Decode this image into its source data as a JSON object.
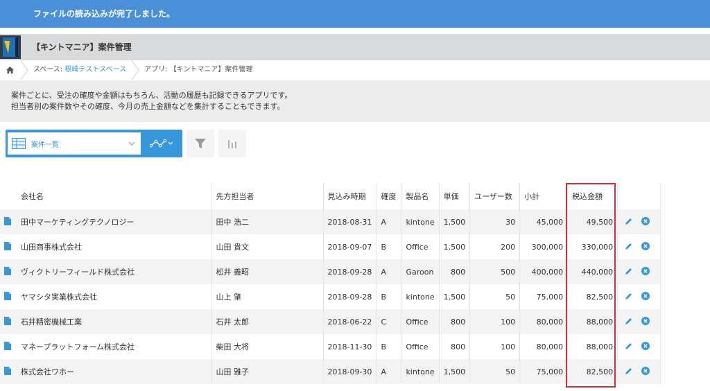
{
  "notification": "ファイルの読み込みが完了しました。",
  "app": {
    "title": "【キントマニア】案件管理"
  },
  "breadcrumb": {
    "space_prefix": "スペース: ",
    "space_name": "根崎テストスペース",
    "app_label": "アプリ: 【キントマニア】案件管理"
  },
  "description": {
    "line1": "案件ごとに、受注の確度や金額はもちろん、活動の履歴も記録できるアプリです。",
    "line2": "担当者別の案件数やその確度、今月の売上金額などを集計することもできます。"
  },
  "view": {
    "selected": "案件一覧"
  },
  "accent": "#3498db",
  "highlight_color": "#d0303a",
  "table": {
    "headers": {
      "company": "会社名",
      "contact": "先方担当者",
      "date": "見込み時期",
      "certainty": "確度",
      "product": "製品名",
      "price": "単価",
      "users": "ユーザー数",
      "subtotal": "小計",
      "total": "税込金額"
    },
    "rows": [
      {
        "company": "田中マーケティングテクノロジー",
        "contact": "田中 浩二",
        "date": "2018-08-31",
        "certainty": "A",
        "product": "kintone",
        "price": "1,500",
        "users": "30",
        "subtotal": "45,000",
        "total": "49,500"
      },
      {
        "company": "山田商事株式会社",
        "contact": "山田 貴文",
        "date": "2018-09-07",
        "certainty": "B",
        "product": "Office",
        "price": "1,500",
        "users": "200",
        "subtotal": "300,000",
        "total": "330,000"
      },
      {
        "company": "ヴィクトリーフィールド株式会社",
        "contact": "松井 義昭",
        "date": "2018-09-28",
        "certainty": "A",
        "product": "Garoon",
        "price": "800",
        "users": "500",
        "subtotal": "400,000",
        "total": "440,000"
      },
      {
        "company": "ヤマシタ実業株式会社",
        "contact": "山上 肇",
        "date": "2018-09-28",
        "certainty": "B",
        "product": "kintone",
        "price": "1,500",
        "users": "50",
        "subtotal": "75,000",
        "total": "82,500"
      },
      {
        "company": "石井精密機械工業",
        "contact": "石井 太郎",
        "date": "2018-06-22",
        "certainty": "C",
        "product": "Office",
        "price": "800",
        "users": "100",
        "subtotal": "80,000",
        "total": "88,000"
      },
      {
        "company": "マネープラットフォーム株式会社",
        "contact": "柴田 大将",
        "date": "2018-11-30",
        "certainty": "B",
        "product": "Office",
        "price": "800",
        "users": "100",
        "subtotal": "80,000",
        "total": "88,000"
      },
      {
        "company": "株式会社ワホー",
        "contact": "山田 雅子",
        "date": "2018-09-30",
        "certainty": "A",
        "product": "kintone",
        "price": "1,500",
        "users": "50",
        "subtotal": "75,000",
        "total": "82,500"
      }
    ]
  }
}
